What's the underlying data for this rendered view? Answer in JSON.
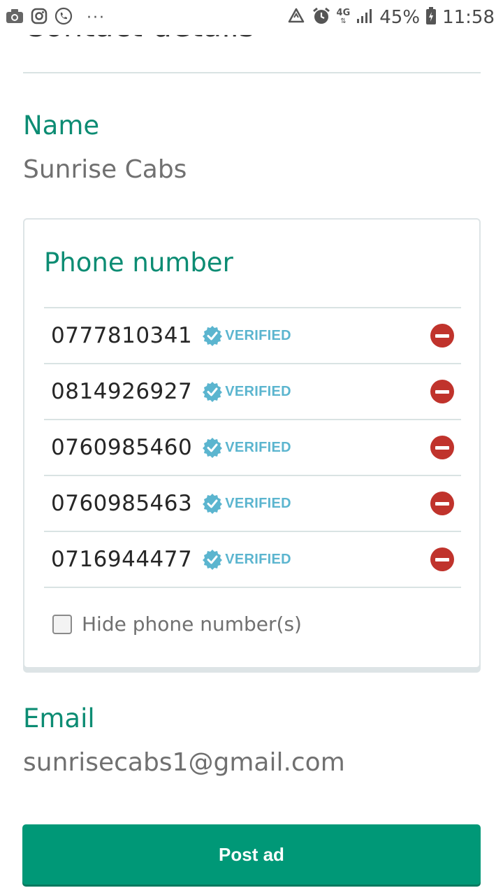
{
  "status_bar": {
    "left_icons": [
      "camera-icon",
      "instagram-icon",
      "phone-call-icon"
    ],
    "overflow": "···",
    "network": "4G",
    "battery_percent": "45%",
    "time": "11:58"
  },
  "contact": {
    "heading": "Contact details",
    "name_label": "Name",
    "name_value": "Sunrise Cabs",
    "phone_label": "Phone number",
    "phones": [
      {
        "number": "0777810341",
        "status": "VERIFIED"
      },
      {
        "number": "0814926927",
        "status": "VERIFIED"
      },
      {
        "number": "0760985460",
        "status": "VERIFIED"
      },
      {
        "number": "0760985463",
        "status": "VERIFIED"
      },
      {
        "number": "0716944477",
        "status": "VERIFIED"
      }
    ],
    "hide_phone_label": "Hide phone number(s)",
    "hide_phone_checked": false,
    "email_label": "Email",
    "email_value": "sunrisecabs1@gmail.com"
  },
  "actions": {
    "post_label": "Post ad"
  },
  "colors": {
    "accent": "#0c8c73",
    "button": "#009877",
    "verified": "#5bb5cf",
    "remove": "#c0332c"
  }
}
